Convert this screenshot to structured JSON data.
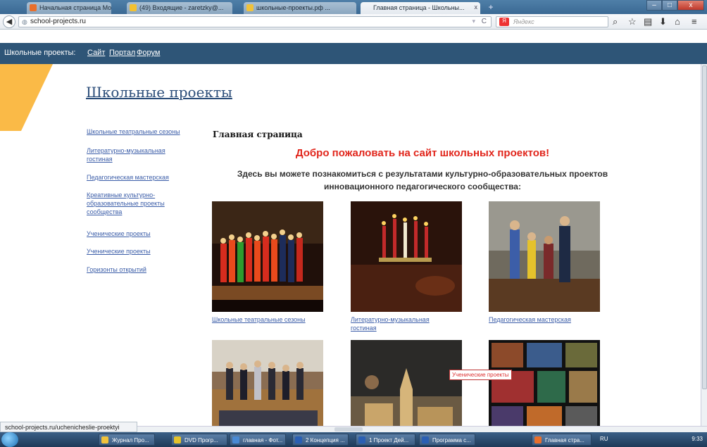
{
  "browser": {
    "tabs": [
      {
        "label": "Начальная страница Моz...",
        "icon_color": "#e86f2c"
      },
      {
        "label": "(49) Входящие - zaretzky@...",
        "icon_color": "#f3c12f"
      },
      {
        "label": "школьные-проекты.рф ...",
        "icon_color": "#f0c23b"
      },
      {
        "label": "Главная страница - Школьны...",
        "icon_color": "#ffffff",
        "active": true
      }
    ],
    "new_tab": "+",
    "url": "school-projects.ru",
    "search_placeholder": "Яндекс",
    "search_engine_icon": "Я",
    "window_buttons": [
      "–",
      "□",
      "x"
    ]
  },
  "site_nav": {
    "label": "Школьные проекты:",
    "links": [
      "Сайт",
      "Портал",
      "Форум"
    ]
  },
  "site_title": "Школьные проекты",
  "sidebar": {
    "items": [
      "Школьные театральные сезоны",
      "Литературно-музыкальная гостиная",
      "Педагогическая мастерская",
      "Креативные культурно-образовательные проекты сообщества",
      "Ученические проекты",
      "Ученические проекты",
      "Горизонты открытий"
    ]
  },
  "main": {
    "heading": "Главная страница",
    "welcome": "Добро пожаловать на сайт школьных проектов!",
    "intro": "Здесь вы можете познакомиться с результатами культурно-образовательных проектов инновационного педагогического сообщества:",
    "gallery": [
      {
        "caption": "Школьные театральные сезоны",
        "scene": "theatre"
      },
      {
        "caption": "Литературно-музыкальная гостиная",
        "scene": "candles"
      },
      {
        "caption": "Педагогическая мастерская",
        "scene": "classroom"
      },
      {
        "caption": "",
        "scene": "hall"
      },
      {
        "caption": "",
        "scene": "models"
      },
      {
        "caption": "",
        "scene": "collage"
      }
    ],
    "tooltip": "Ученические проекты"
  },
  "status_url": "school-projects.ru/uchenicheslie-proektyi",
  "taskbar": {
    "tasks": [
      "Журнал Про...",
      "DVD Прогр...",
      "главная - Фот...",
      "2 Концепция ...",
      "1 Проект Дей...",
      "Программа с...",
      "Главная стра..."
    ],
    "language": "RU",
    "clock": "9:33"
  }
}
